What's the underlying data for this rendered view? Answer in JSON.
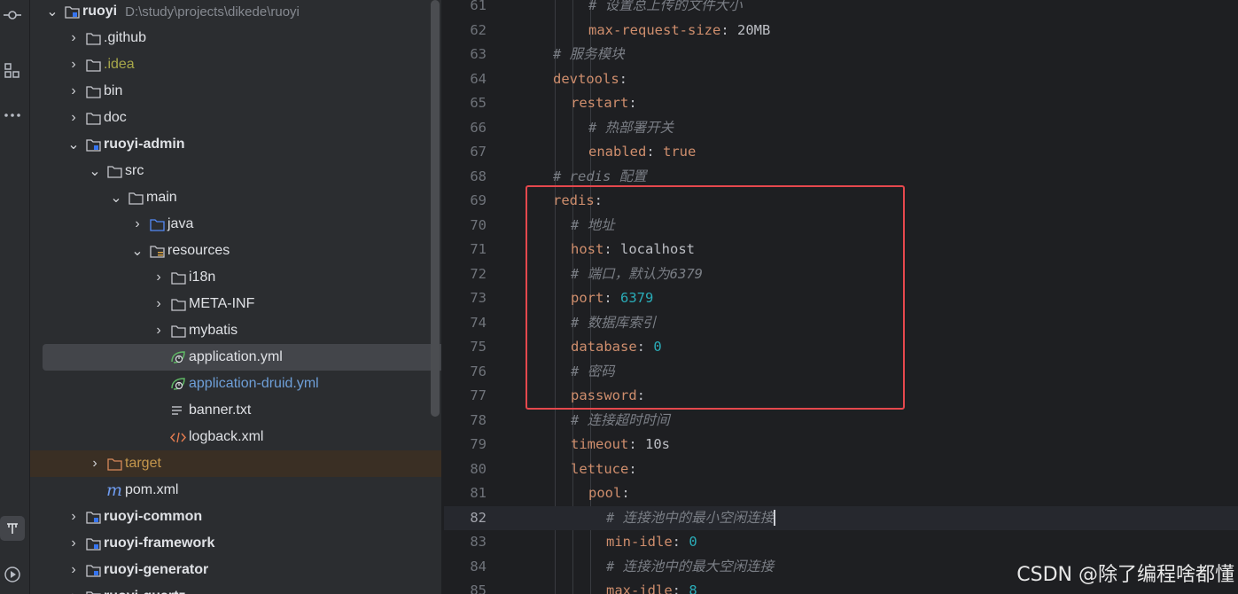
{
  "toolstrip": {
    "icons": [
      "commit-icon",
      "structure-icon",
      "more-icon",
      "services-icon",
      "run-icon"
    ]
  },
  "tree": {
    "root": {
      "label": "ruoyi",
      "path": "D:\\study\\projects\\dikede\\ruoyi"
    },
    "items": [
      {
        "label": ".github"
      },
      {
        "label": ".idea"
      },
      {
        "label": "bin"
      },
      {
        "label": "doc"
      },
      {
        "label": "ruoyi-admin"
      },
      {
        "label": "src"
      },
      {
        "label": "main"
      },
      {
        "label": "java"
      },
      {
        "label": "resources"
      },
      {
        "label": "i18n"
      },
      {
        "label": "META-INF"
      },
      {
        "label": "mybatis"
      },
      {
        "label": "application.yml"
      },
      {
        "label": "application-druid.yml"
      },
      {
        "label": "banner.txt"
      },
      {
        "label": "logback.xml"
      },
      {
        "label": "target"
      },
      {
        "label": "pom.xml"
      },
      {
        "label": "ruoyi-common"
      },
      {
        "label": "ruoyi-framework"
      },
      {
        "label": "ruoyi-generator"
      },
      {
        "label": "ruoyi-quartz"
      }
    ]
  },
  "editor": {
    "lines": [
      {
        "n": "61",
        "t": "# 设置总上传的文件大小"
      },
      {
        "n": "62",
        "k": "max-request-size",
        "v": "20MB"
      },
      {
        "n": "63",
        "t": "# 服务模块"
      },
      {
        "n": "64",
        "k": "devtools"
      },
      {
        "n": "65",
        "k": "restart"
      },
      {
        "n": "66",
        "t": "# 热部署开关"
      },
      {
        "n": "67",
        "k": "enabled",
        "v": "true"
      },
      {
        "n": "68",
        "t": "# redis 配置"
      },
      {
        "n": "69",
        "k": "redis"
      },
      {
        "n": "70",
        "t": "# 地址"
      },
      {
        "n": "71",
        "k": "host",
        "v": "localhost"
      },
      {
        "n": "72",
        "t": "# 端口，默认为6379"
      },
      {
        "n": "73",
        "k": "port",
        "v": "6379"
      },
      {
        "n": "74",
        "t": "# 数据库索引"
      },
      {
        "n": "75",
        "k": "database",
        "v": "0"
      },
      {
        "n": "76",
        "t": "# 密码"
      },
      {
        "n": "77",
        "k": "password"
      },
      {
        "n": "78",
        "t": "# 连接超时时间"
      },
      {
        "n": "79",
        "k": "timeout",
        "v": "10s"
      },
      {
        "n": "80",
        "k": "lettuce"
      },
      {
        "n": "81",
        "k": "pool"
      },
      {
        "n": "82",
        "t": "# 连接池中的最小空闲连接"
      },
      {
        "n": "83",
        "k": "min-idle",
        "v": "0"
      },
      {
        "n": "84",
        "t": "# 连接池中的最大空闲连接"
      },
      {
        "n": "85",
        "k": "max-idle",
        "v": "8"
      }
    ],
    "colon": ":"
  },
  "watermark": "CSDN @除了编程啥都懂"
}
